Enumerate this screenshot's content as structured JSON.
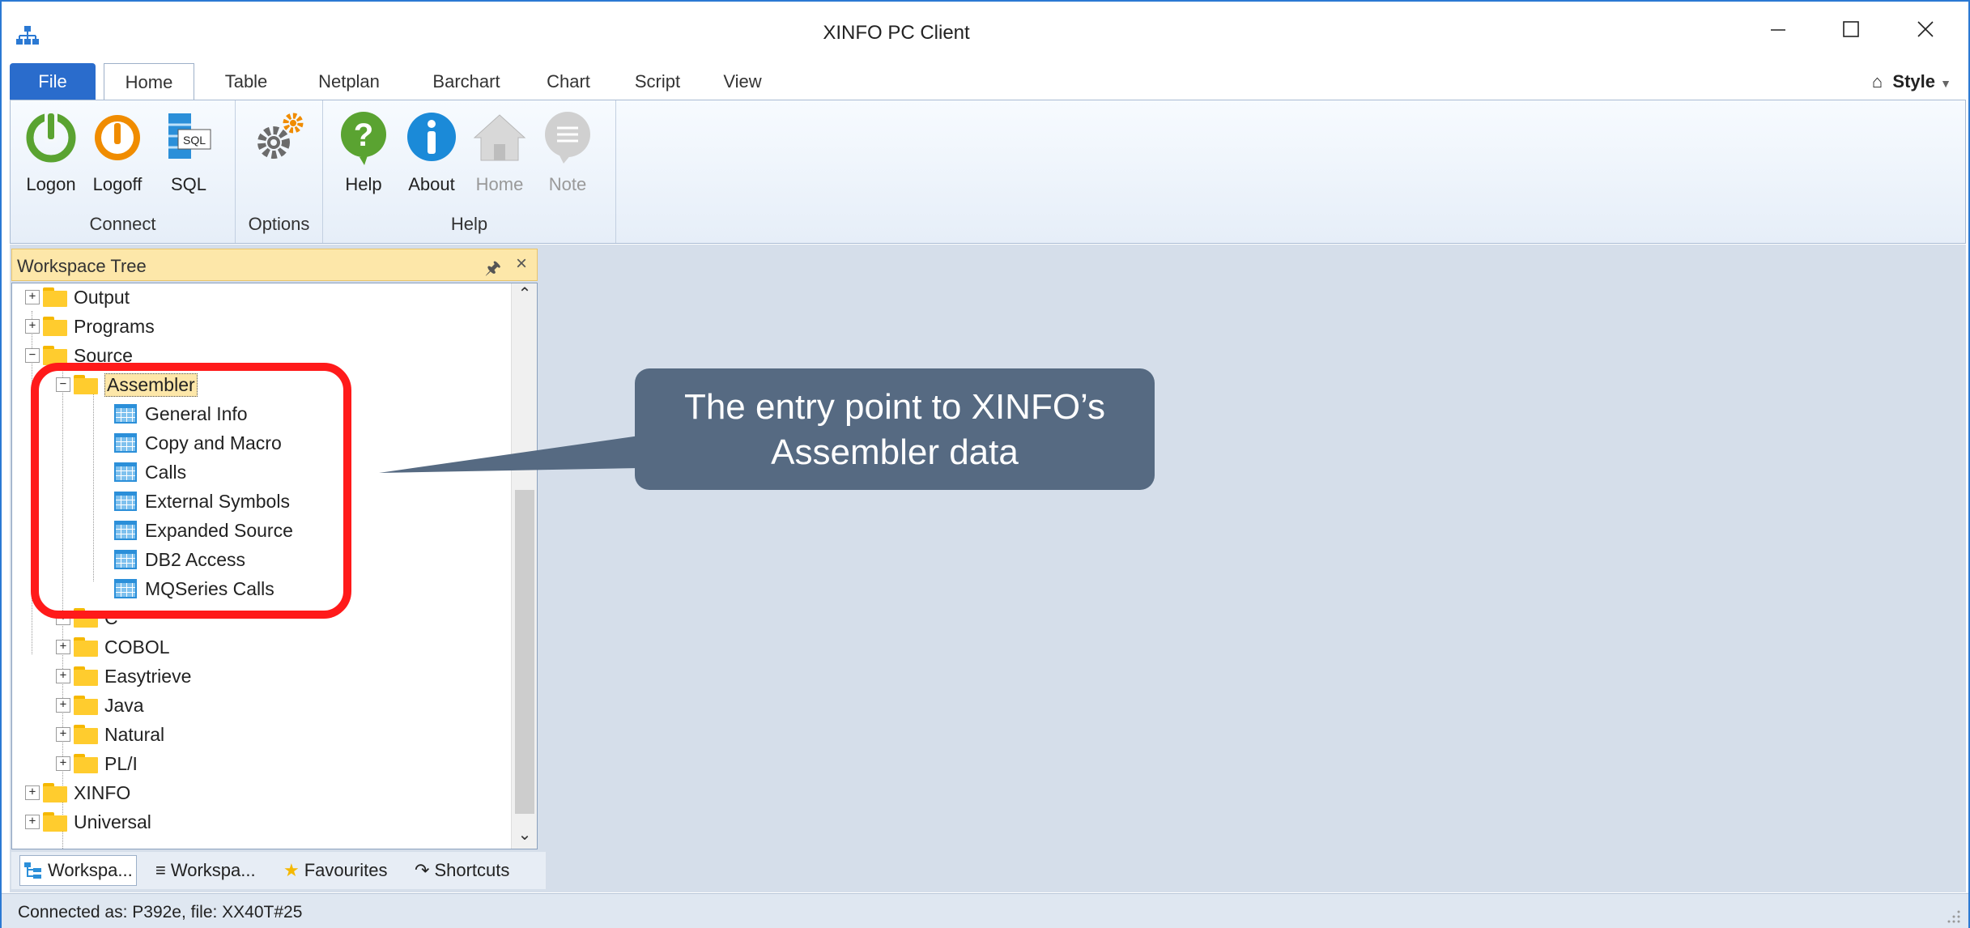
{
  "window": {
    "title": "XINFO PC Client",
    "minimize_label": "Minimize",
    "maximize_label": "Maximize",
    "close_label": "Close"
  },
  "ribbon_tabs": [
    "File",
    "Home",
    "Table",
    "Netplan",
    "Barchart",
    "Chart",
    "Script",
    "View"
  ],
  "style_label": "Style",
  "ribbon": {
    "connect": {
      "label": "Connect",
      "buttons": [
        "Logon",
        "Logoff",
        "SQL"
      ]
    },
    "options": {
      "label": "Options"
    },
    "help": {
      "label": "Help",
      "buttons": [
        "Help",
        "About",
        "Home",
        "Note"
      ]
    }
  },
  "workspace": {
    "title": "Workspace Tree",
    "pin": "ᵩ",
    "close": "×",
    "tree": [
      "Output",
      "Programs",
      "Source",
      "Assembler",
      "General Info",
      "Copy and Macro",
      "Calls",
      "External Symbols",
      "Expanded Source",
      "DB2 Access",
      "MQSeries Calls",
      "C",
      "COBOL",
      "Easytrieve",
      "Java",
      "Natural",
      "PL/I",
      "XINFO",
      "Universal"
    ],
    "tabs": [
      "Workspa...",
      "Workspa...",
      "Favourites",
      "Shortcuts"
    ]
  },
  "status": {
    "text": "Connected as: P392e, file: XX40T#25"
  },
  "annotation": {
    "line1": "The entry point to XINFO’s",
    "line2": "Assembler data"
  },
  "colors": {
    "accent": "#2a6ccc",
    "panel_header": "#fde7a9",
    "callout": "#566a82",
    "highlight": "#ff1a1a"
  }
}
